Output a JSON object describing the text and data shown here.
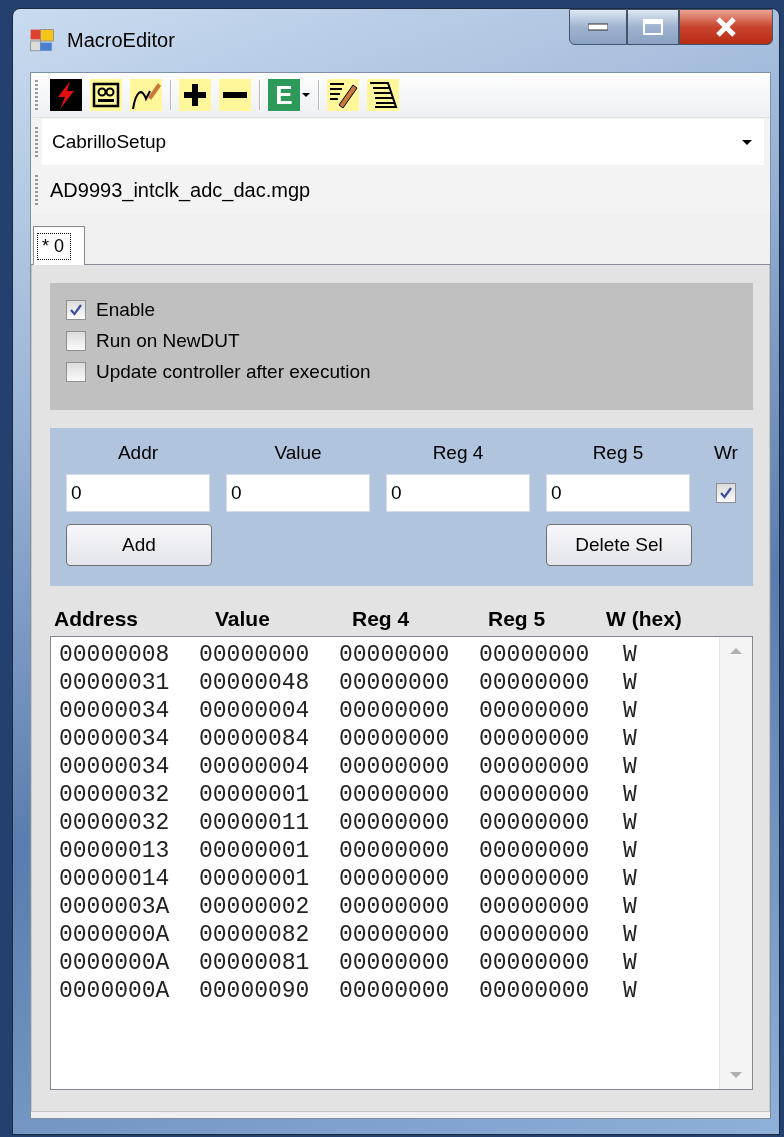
{
  "window": {
    "title": "MacroEditor"
  },
  "toolbar": [
    {
      "kind": "button"
    },
    {
      "kind": "button"
    },
    {
      "kind": "button"
    },
    {
      "kind": "separator"
    },
    {
      "kind": "button"
    },
    {
      "kind": "button"
    },
    {
      "kind": "separator"
    },
    {
      "kind": "dropdown",
      "text": "E"
    },
    {
      "kind": "separator"
    },
    {
      "kind": "button"
    },
    {
      "kind": "button"
    }
  ],
  "setup_combo": {
    "value": "CabrilloSetup"
  },
  "file_name": "AD9993_intclk_adc_dac.mgp",
  "tabs": [
    {
      "label": "* 0",
      "selected": true
    }
  ],
  "options": [
    {
      "label": "Enable",
      "checked": true
    },
    {
      "label": "Run on NewDUT",
      "checked": false
    },
    {
      "label": "Update controller after execution",
      "checked": false
    }
  ],
  "entry": {
    "fields": [
      {
        "label": "Addr",
        "value": "0"
      },
      {
        "label": "Value",
        "value": "0"
      },
      {
        "label": "Reg 4",
        "value": "0"
      },
      {
        "label": "Reg 5",
        "value": "0"
      }
    ],
    "write": {
      "label": "Wr",
      "checked": true
    },
    "buttons": [
      "Add",
      "Delete Sel"
    ]
  },
  "table": {
    "columns": [
      "Address",
      "Value",
      "Reg 4",
      "Reg 5",
      "W (hex)"
    ],
    "rows": [
      [
        "00000008",
        "00000000",
        "00000000",
        "00000000",
        "W"
      ],
      [
        "00000031",
        "00000048",
        "00000000",
        "00000000",
        "W"
      ],
      [
        "00000034",
        "00000004",
        "00000000",
        "00000000",
        "W"
      ],
      [
        "00000034",
        "00000084",
        "00000000",
        "00000000",
        "W"
      ],
      [
        "00000034",
        "00000004",
        "00000000",
        "00000000",
        "W"
      ],
      [
        "00000032",
        "00000001",
        "00000000",
        "00000000",
        "W"
      ],
      [
        "00000032",
        "00000011",
        "00000000",
        "00000000",
        "W"
      ],
      [
        "00000013",
        "00000001",
        "00000000",
        "00000000",
        "W"
      ],
      [
        "00000014",
        "00000001",
        "00000000",
        "00000000",
        "W"
      ],
      [
        "0000003A",
        "00000002",
        "00000000",
        "00000000",
        "W"
      ],
      [
        "0000000A",
        "00000082",
        "00000000",
        "00000000",
        "W"
      ],
      [
        "0000000A",
        "00000081",
        "00000000",
        "00000000",
        "W"
      ],
      [
        "0000000A",
        "00000090",
        "00000000",
        "00000000",
        "W"
      ]
    ]
  }
}
